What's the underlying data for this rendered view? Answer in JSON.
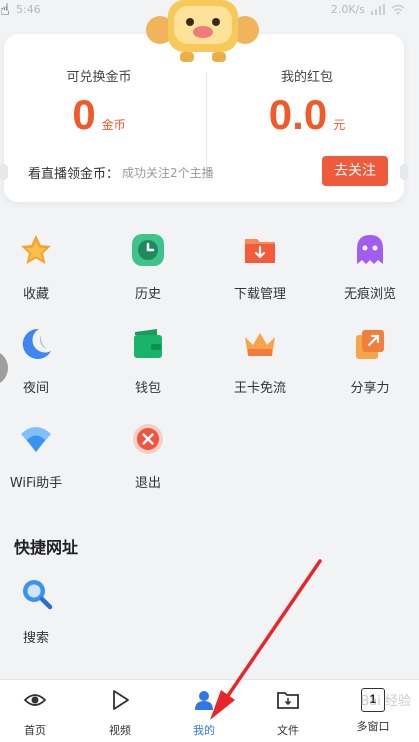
{
  "status_bar": {
    "time": "5:46",
    "network": "2.0K/s"
  },
  "card": {
    "coins_label": "可兑换金币",
    "coins_value": "0",
    "coins_unit": "金币",
    "redpack_label": "我的红包",
    "redpack_value": "0.0",
    "redpack_unit": "元",
    "live_title": "看直播领金币：",
    "live_sub": "成功关注2个主播",
    "follow_label": "去关注"
  },
  "grid": [
    {
      "label": "收藏",
      "icon": "star-icon"
    },
    {
      "label": "历史",
      "icon": "clock-icon"
    },
    {
      "label": "下载管理",
      "icon": "download-folder-icon"
    },
    {
      "label": "无痕浏览",
      "icon": "ghost-icon"
    },
    {
      "label": "夜间",
      "icon": "moon-icon"
    },
    {
      "label": "钱包",
      "icon": "wallet-icon"
    },
    {
      "label": "王卡免流",
      "icon": "crown-icon"
    },
    {
      "label": "分享力",
      "icon": "share-icon"
    },
    {
      "label": "WiFi助手",
      "icon": "wifi-icon"
    },
    {
      "label": "退出",
      "icon": "close-circle-icon"
    }
  ],
  "quick_title": "快捷网址",
  "quick": [
    {
      "label": "搜索",
      "icon": "search-icon"
    }
  ],
  "nav": [
    {
      "label": "首页",
      "icon": "eye-icon"
    },
    {
      "label": "视频",
      "icon": "play-icon"
    },
    {
      "label": "我的",
      "icon": "user-icon"
    },
    {
      "label": "文件",
      "icon": "file-download-icon"
    },
    {
      "label": "多窗口",
      "icon": "window-count-icon",
      "count": "1"
    }
  ],
  "colors": {
    "accent": "#ef5a3a",
    "active_nav": "#2f76e8"
  }
}
